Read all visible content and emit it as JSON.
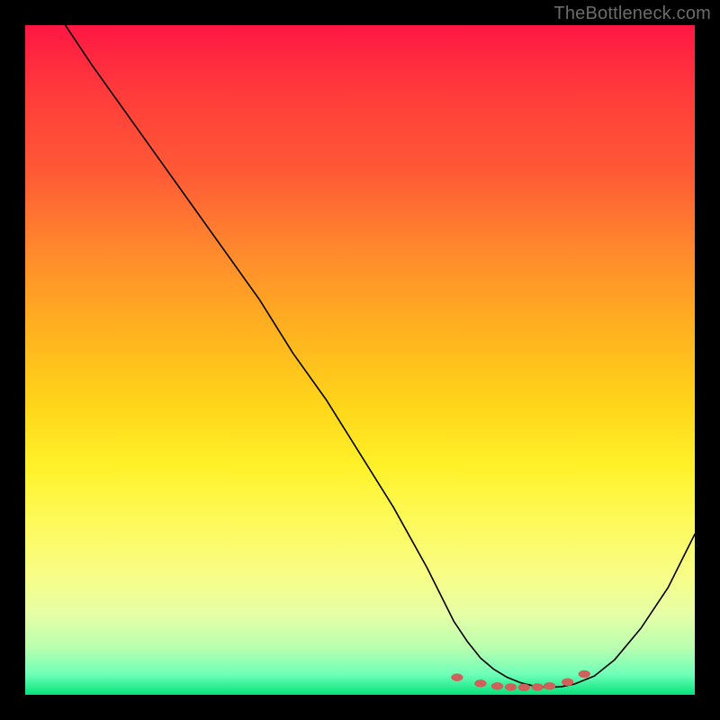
{
  "watermark": "TheBottleneck.com",
  "chart_data": {
    "type": "line",
    "title": "",
    "xlabel": "",
    "ylabel": "",
    "xlim": [
      0,
      100
    ],
    "ylim": [
      0,
      100
    ],
    "grid": false,
    "series": [
      {
        "name": "curve",
        "stroke": "#000000",
        "x": [
          6,
          10,
          15,
          20,
          25,
          30,
          35,
          40,
          45,
          50,
          55,
          60,
          62,
          64,
          66,
          68,
          70,
          72,
          74,
          76,
          78,
          80,
          82,
          85,
          88,
          92,
          96,
          100
        ],
        "y": [
          100,
          94,
          87,
          80,
          73,
          66,
          59,
          51,
          44,
          36,
          28,
          19,
          15,
          11,
          8,
          5.5,
          3.8,
          2.6,
          1.8,
          1.3,
          1.1,
          1.2,
          1.6,
          2.8,
          5.2,
          10,
          16,
          24
        ]
      }
    ],
    "markers": {
      "stroke": "#d1605b",
      "fill": "#d1605b",
      "points": [
        {
          "x": 64.5,
          "y": 2.6
        },
        {
          "x": 68.0,
          "y": 1.7
        },
        {
          "x": 70.5,
          "y": 1.3
        },
        {
          "x": 72.5,
          "y": 1.15
        },
        {
          "x": 74.5,
          "y": 1.1
        },
        {
          "x": 76.5,
          "y": 1.15
        },
        {
          "x": 78.3,
          "y": 1.3
        },
        {
          "x": 81.0,
          "y": 1.9
        },
        {
          "x": 83.5,
          "y": 3.1
        }
      ],
      "rx": 6.5,
      "ry": 4.0
    }
  }
}
